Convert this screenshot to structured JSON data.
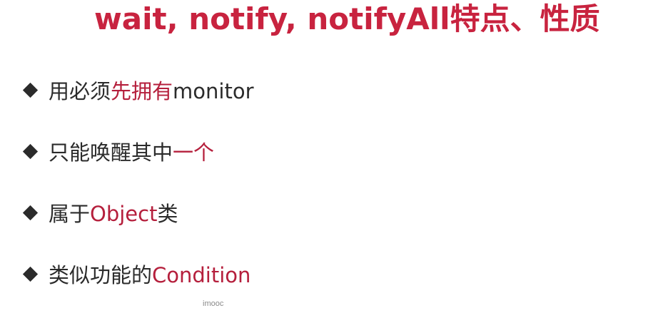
{
  "slide": {
    "title": "wait, notify, notifyAll特点、性质",
    "bullets": [
      {
        "text_before": "用必须",
        "highlight": "先拥有",
        "text_after": "monitor"
      },
      {
        "text_before": "只能唤醒其中",
        "highlight": "一个",
        "text_after": ""
      },
      {
        "text_before": "属于",
        "highlight": "Object",
        "text_after": "类"
      },
      {
        "text_before": "类似功能的",
        "highlight": "Condition",
        "text_after": ""
      }
    ],
    "bullet_icon": "diamond-bullet-icon",
    "watermark": "imooc"
  },
  "colors": {
    "title": "#c8233f",
    "highlight": "#b51f3c",
    "body_text": "#2b2b2b",
    "background": "#ffffff"
  }
}
